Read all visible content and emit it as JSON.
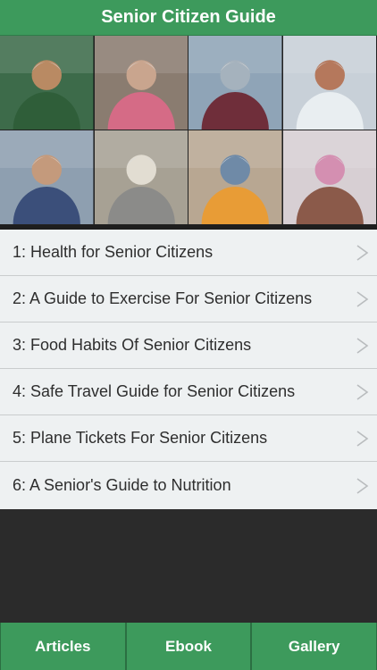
{
  "header": {
    "title": "Senior Citizen Guide"
  },
  "banner": {
    "tiles": [
      {
        "name": "grocer-photo-tile",
        "colors": [
          "#3d6b4a",
          "#b98a63",
          "#2f5e39"
        ]
      },
      {
        "name": "caregiver-photo-tile",
        "colors": [
          "#8a7c70",
          "#c9a58e",
          "#d56b86"
        ]
      },
      {
        "name": "city-walk-photo-tile",
        "colors": [
          "#8fa4b7",
          "#a5b2bd",
          "#6f2e3a"
        ]
      },
      {
        "name": "doctor-photo-tile",
        "colors": [
          "#c8d0d8",
          "#b5785c",
          "#e9eef1"
        ]
      },
      {
        "name": "smiling-man-photo-tile",
        "colors": [
          "#8e9fb0",
          "#c49a7c",
          "#3b4f7a"
        ]
      },
      {
        "name": "couple-photo-tile",
        "colors": [
          "#a7a194",
          "#e2ddd2",
          "#8b8b89"
        ]
      },
      {
        "name": "grandparent-child-photo-tile",
        "colors": [
          "#b8a792",
          "#6f8aa7",
          "#e89c36"
        ]
      },
      {
        "name": "mother-daughter-photo-tile",
        "colors": [
          "#d7cfd3",
          "#d48fb1",
          "#8b5a4a"
        ]
      }
    ]
  },
  "list": {
    "items": [
      {
        "label": "1: Health for Senior Citizens"
      },
      {
        "label": "2: A Guide to Exercise For Senior Citizens"
      },
      {
        "label": "3: Food Habits Of Senior Citizens"
      },
      {
        "label": "4: Safe Travel Guide for Senior Citizens"
      },
      {
        "label": "5: Plane Tickets For Senior Citizens"
      },
      {
        "label": "6: A Senior's Guide to Nutrition"
      }
    ],
    "chevron_icon": "chevron-right-icon"
  },
  "tabbar": {
    "tabs": [
      {
        "label": "Articles"
      },
      {
        "label": "Ebook"
      },
      {
        "label": "Gallery"
      }
    ]
  },
  "colors": {
    "accent": "#3d9a5c",
    "list_bg": "#eef1f2",
    "empty_area": "#2b2b2b"
  }
}
